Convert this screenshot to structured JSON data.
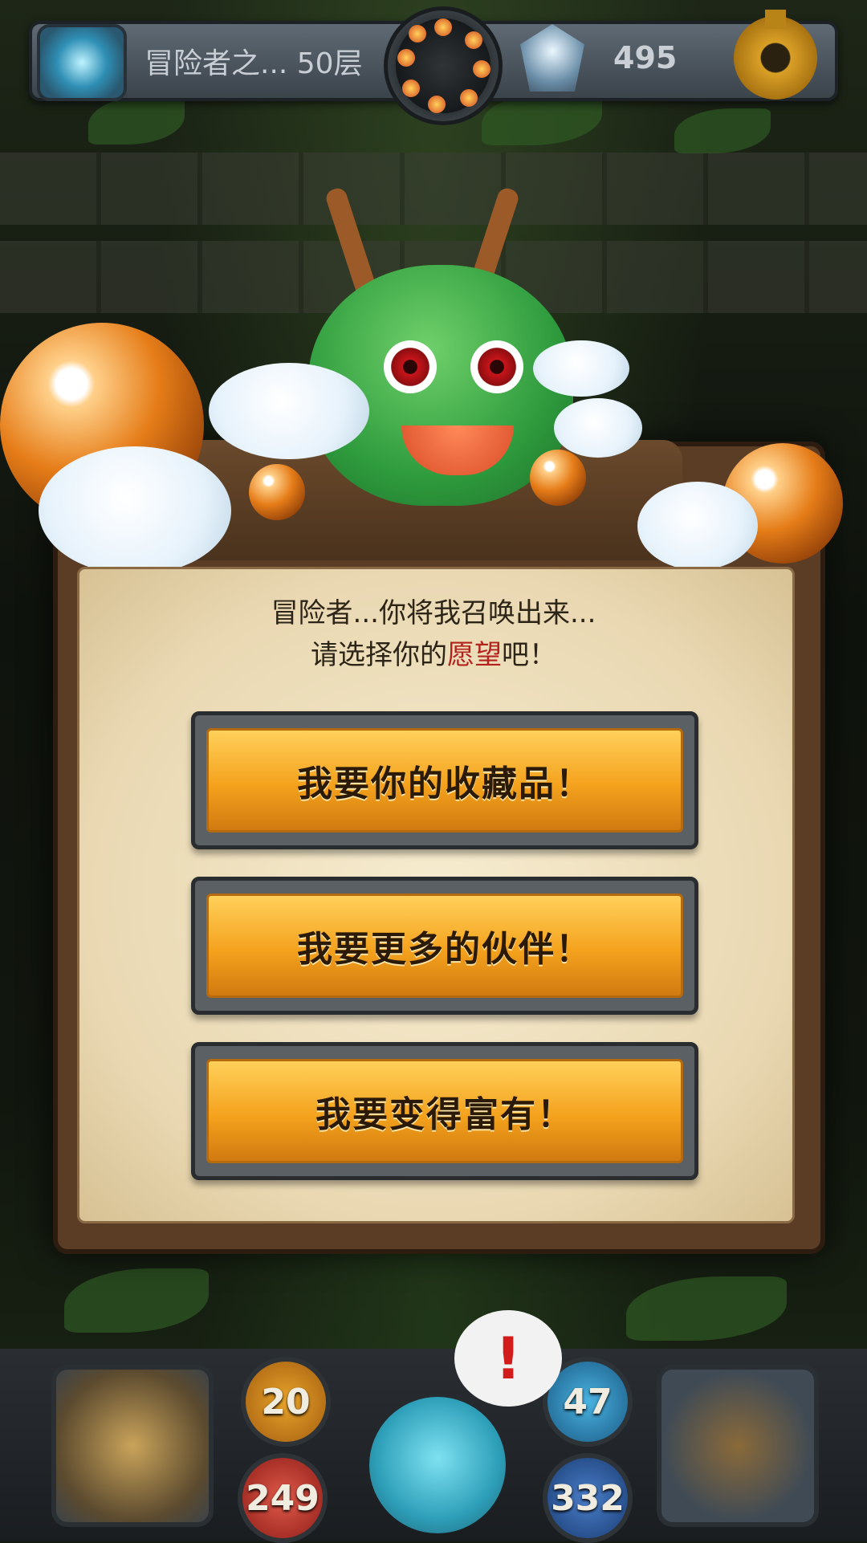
{
  "top_bar": {
    "floor_label": "冒险者之... 50层",
    "gold_amount": "495"
  },
  "dialog": {
    "message_line1": "冒险者...你将我召唤出来...",
    "message_line2_prefix": "请选择你的",
    "message_line2_highlight": "愿望",
    "message_line2_suffix": "吧！",
    "options": [
      {
        "label": "我要你的收藏品！"
      },
      {
        "label": "我要更多的伙伴！"
      },
      {
        "label": "我要变得富有！"
      }
    ]
  },
  "bottom_hud": {
    "attack": "20",
    "hp": "249",
    "magic": "47",
    "defense": "332",
    "alert_symbol": "!"
  },
  "colors": {
    "button_gold": "#f4a21d",
    "highlight_red": "#b3221d",
    "parchment": "#f0e2c0"
  }
}
